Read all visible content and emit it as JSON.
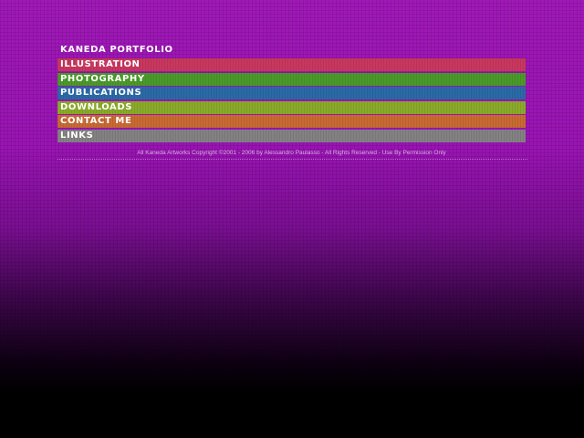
{
  "brand": {
    "title": "KANEDA PORTFOLIO"
  },
  "menu": {
    "items": [
      {
        "label": "ILLUSTRATION",
        "color": "#c8385e"
      },
      {
        "label": "PHOTOGRAPHY",
        "color": "#4a9a2a"
      },
      {
        "label": "PUBLICATIONS",
        "color": "#2a6aa6"
      },
      {
        "label": "DOWNLOADS",
        "color": "#8aaa2a"
      },
      {
        "label": "CONTACT ME",
        "color": "#c86a32"
      },
      {
        "label": "LINKS",
        "color": "#828282"
      }
    ]
  },
  "footer": {
    "copyright": "All Kaneda Artworks Copyright ©2001 - 2006 by Alessandro Paulasso - All Rights Reserved - Use By Permission Only"
  }
}
